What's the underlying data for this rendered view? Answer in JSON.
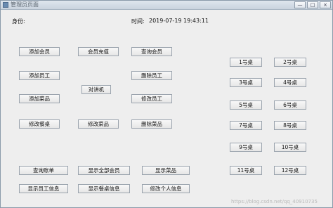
{
  "window": {
    "title": "管理员页面"
  },
  "header": {
    "identity_label": "身份:",
    "time_label": "时间:",
    "time_value": "2019-07-19 19:43:11"
  },
  "buttons": {
    "add_member": "添加会员",
    "member_recharge": "会员充值",
    "query_member": "查询会员",
    "add_employee": "添加员工",
    "delete_employee": "删除员工",
    "intercom": "对讲机",
    "add_dish": "添加菜品",
    "modify_employee": "修改员工",
    "modify_table": "修改餐桌",
    "modify_dish": "修改菜品",
    "delete_dish": "删除菜品",
    "query_bill": "查询账单",
    "show_all_members": "显示全部会员",
    "show_dishes": "显示菜品",
    "show_employee_info": "显示员工信息",
    "show_table_info": "显示餐桌信息",
    "modify_personal_info": "修改个人信息"
  },
  "tables": [
    "1号桌",
    "2号桌",
    "3号桌",
    "4号桌",
    "5号桌",
    "6号桌",
    "7号桌",
    "8号桌",
    "9号桌",
    "10号桌",
    "11号桌",
    "12号桌"
  ],
  "watermark": "https://blog.csdn.net/qq_40910735"
}
